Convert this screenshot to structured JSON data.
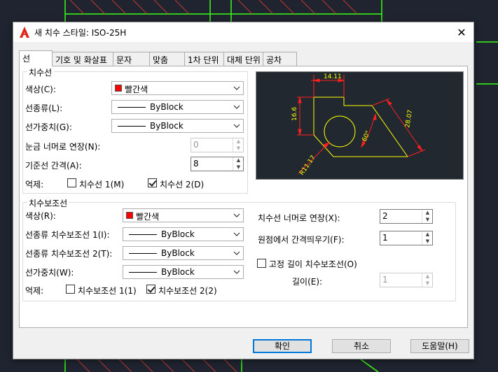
{
  "dialog": {
    "title": "새 치수 스타일: ISO-25H",
    "close_label": "✕"
  },
  "tabs": [
    {
      "label": "선",
      "active": true
    },
    {
      "label": "기호 및 화살표",
      "active": false
    },
    {
      "label": "문자",
      "active": false
    },
    {
      "label": "맞춤",
      "active": false
    },
    {
      "label": "1차 단위",
      "active": false
    },
    {
      "label": "대체 단위",
      "active": false
    },
    {
      "label": "공차",
      "active": false
    }
  ],
  "dim_lines": {
    "group_title": "치수선",
    "color_label": "색상(C):",
    "color_value": "빨간색",
    "linetype_label": "선종류(L):",
    "linetype_value": "ByBlock",
    "lineweight_label": "선가중치(G):",
    "lineweight_value": "ByBlock",
    "extend_ticks_label": "눈금 너머로 연장(N):",
    "extend_ticks_value": "0",
    "baseline_spacing_label": "기준선 간격(A):",
    "baseline_spacing_value": "8",
    "suppress_label": "억제:",
    "suppress_1_label": "치수선 1(M)",
    "suppress_1_checked": false,
    "suppress_2_label": "치수선 2(D)",
    "suppress_2_checked": true
  },
  "ext_lines": {
    "group_title": "치수보조선",
    "color_label": "색상(R):",
    "color_value": "빨간색",
    "linetype1_label": "선종류 치수보조선 1(I):",
    "linetype1_value": "ByBlock",
    "linetype2_label": "선종류 치수보조선 2(T):",
    "linetype2_value": "ByBlock",
    "lineweight_label": "선가중치(W):",
    "lineweight_value": "ByBlock",
    "suppress_label": "억제:",
    "suppress_1_label": "치수보조선 1(1)",
    "suppress_1_checked": false,
    "suppress_2_label": "치수보조선 2(2)",
    "suppress_2_checked": true,
    "extend_beyond_label": "치수선 너머로 연장(X):",
    "extend_beyond_value": "2",
    "offset_label": "원점에서 간격띄우기(F):",
    "offset_value": "1",
    "fixed_length_label": "고정 길이 치수보조선(O)",
    "fixed_length_checked": false,
    "length_label": "길이(E):",
    "length_value": "1"
  },
  "preview": {
    "dim_top": "14.11",
    "dim_left": "16.6",
    "dim_right": "28.07",
    "dim_angle": "60°",
    "dim_radius": "R11.17"
  },
  "buttons": {
    "ok": "확인",
    "cancel": "취소",
    "help": "도움말(H)"
  },
  "colors": {
    "accent": "#0078d7",
    "cad_background": "#1f2430",
    "preview_background": "#212830",
    "dim_color": "#ff0000",
    "geometry_color": "#ffff00"
  }
}
